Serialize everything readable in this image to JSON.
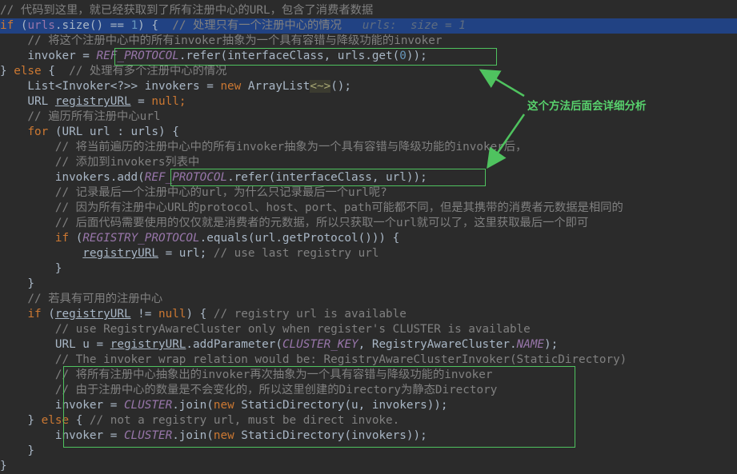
{
  "code": {
    "l0": "// 代码到这里，就已经获取到了所有注册中心的URL，包含了消费者数据",
    "l1a": "if",
    "l1b": " (",
    "l1c": "urls",
    "l1d": ".size() == ",
    "l1e": "1",
    "l1f": ") {  ",
    "l1g": "// 处理只有一个注册中心的情况",
    "l1h": "   urls:  size = 1",
    "l2": "    // 将这个注册中心中的所有invoker抽象为一个具有容错与降级功能的invoker",
    "l3a": "    invoker = ",
    "l3b": "REF_PROTOCOL",
    "l3c": ".refer(interfaceClass, urls.get(",
    "l3d": "0",
    "l3e": "));",
    "l4a": "} ",
    "l4b": "else",
    "l4c": " {  ",
    "l4d": "// 处理有多个注册中心的情况",
    "l5a": "    List<Invoker<?>> invokers = ",
    "l5b": "new",
    "l5c": " ArrayList",
    "l5d": "<~>",
    "l5e": "();",
    "l6a": "    URL ",
    "l6b": "registryURL",
    "l6c": " = ",
    "l6d": "null",
    "l6e": ";",
    "l7": "    // 遍历所有注册中心url",
    "l8a": "    ",
    "l8b": "for",
    "l8c": " (URL url : urls) {",
    "l9": "        // 将当前遍历的注册中心中的所有invoker抽象为一个具有容错与降级功能的invoker后，",
    "l10": "        // 添加到invokers列表中",
    "l11a": "        invokers.add(",
    "l11b": "REF_PROTOCOL",
    "l11c": ".refer(interfaceClass, url));",
    "l12": "        // 记录最后一个注册中心的url，为什么只记录最后一个url呢?",
    "l13": "        // 因为所有注册中心URL的protocol、host、port、path可能都不同，但是其携带的消费者元数据是相同的",
    "l14": "        // 后面代码需要使用的仅仅就是消费者的元数据，所以只获取一个url就可以了，这里获取最后一个即可",
    "l15a": "        ",
    "l15b": "if",
    "l15c": " (",
    "l15d": "REGISTRY_PROTOCOL",
    "l15e": ".equals(url.getProtocol())) {",
    "l16a": "            ",
    "l16b": "registryURL",
    "l16c": " = url; ",
    "l16d": "// use last registry url",
    "l17": "        }",
    "l18": "    }",
    "l19": "    // 若具有可用的注册中心",
    "l20a": "    ",
    "l20b": "if",
    "l20c": " (",
    "l20d": "registryURL",
    "l20e": " != ",
    "l20f": "null",
    "l20g": ") { ",
    "l20h": "// registry url is available",
    "l21": "        // use RegistryAwareCluster only when register's CLUSTER is available",
    "l22a": "        URL u = ",
    "l22b": "registryURL",
    "l22c": ".addParameter(",
    "l22d": "CLUSTER_KEY",
    "l22e": ", RegistryAwareCluster.",
    "l22f": "NAME",
    "l22g": ");",
    "l23": "        // The invoker wrap relation would be: RegistryAwareClusterInvoker(StaticDirectory)",
    "l24": "        // 将所有注册中心抽象出的invoker再次抽象为一个具有容错与降级功能的invoker",
    "l25": "        // 由于注册中心的数量是不会变化的，所以这里创建的Directory为静态Directory",
    "l26a": "        invoker = ",
    "l26b": "CLUSTER",
    "l26c": ".join(",
    "l26d": "new",
    "l26e": " StaticDirectory(u, invokers));",
    "l27a": "    } ",
    "l27b": "else",
    "l27c": " { ",
    "l27d": "// not a registry url, must be direct invoke.",
    "l28a": "        invoker = ",
    "l28b": "CLUSTER",
    "l28c": ".join(",
    "l28d": "new",
    "l28e": " StaticDirectory(invokers));",
    "l29": "    }",
    "l30": "}"
  },
  "annotation": {
    "label": "这个方法后面会详细分析"
  },
  "theme": {
    "background": "#2b2b2b",
    "highlight": "#214283",
    "keyword": "#cc7832",
    "comment": "#808080",
    "field": "#9876aa",
    "number": "#6897bb",
    "annotation": "#4fc35f"
  }
}
